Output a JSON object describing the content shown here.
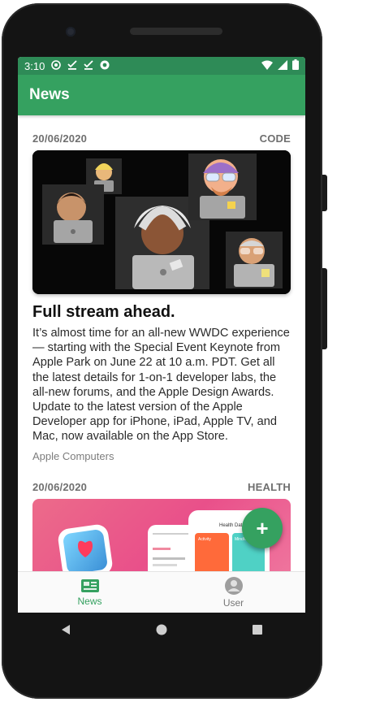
{
  "status_bar": {
    "time": "3:10",
    "left_icons": [
      "at-sign-icon",
      "check-download-icon",
      "check-download-icon",
      "chrome-icon"
    ],
    "right_icons": [
      "wifi-icon",
      "signal-icon",
      "battery-icon"
    ]
  },
  "app_bar": {
    "title": "News"
  },
  "articles": [
    {
      "date": "20/06/2020",
      "category": "CODE",
      "title": "Full stream ahead.",
      "body": "It’s almost time for an all-new WWDC experience — starting with the Special Event Keynote from Apple Park on June 22 at 10 a.m. PDT. Get all the latest details for 1-on-1 developer labs, the all-new forums, and the Apple Design Awards. Update to the latest version of the Apple Developer app for iPhone, iPad, Apple TV, and Mac, now available on the App Store.",
      "source": "Apple Computers"
    },
    {
      "date": "20/06/2020",
      "category": "HEALTH",
      "image_texts": [
        "Health Data",
        "Activity",
        "Mindfulness"
      ]
    }
  ],
  "fab": {
    "label": "+"
  },
  "bottom_nav": {
    "items": [
      {
        "label": "News",
        "icon": "news-icon",
        "active": true
      },
      {
        "label": "User",
        "icon": "user-icon",
        "active": false
      }
    ]
  },
  "colors": {
    "primary": "#35a160",
    "status_bar": "#2e8b57",
    "accent": "#35a160"
  }
}
